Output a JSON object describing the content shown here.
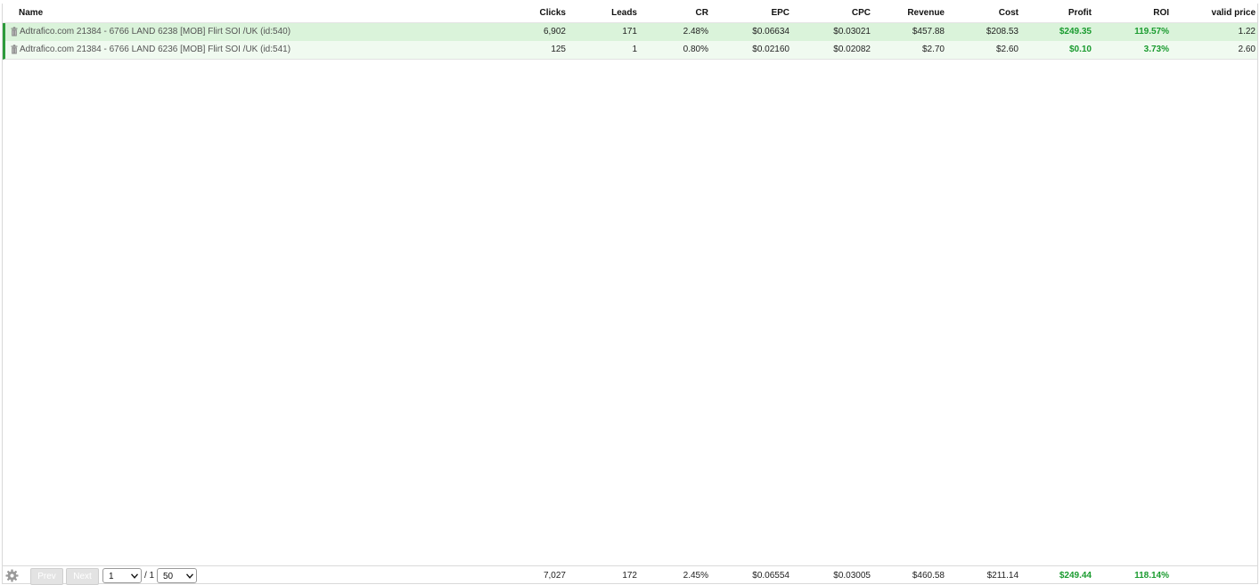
{
  "table": {
    "columns": [
      "Name",
      "Clicks",
      "Leads",
      "CR",
      "EPC",
      "CPC",
      "Revenue",
      "Cost",
      "Profit",
      "ROI",
      "valid price"
    ],
    "rows": [
      {
        "name": "Adtrafico.com 21384 - 6766 LAND 6238 [MOB] Flirt SOI /UK (id:540)",
        "clicks": "6,902",
        "leads": "171",
        "cr": "2.48%",
        "epc": "$0.06634",
        "cpc": "$0.03021",
        "revenue": "$457.88",
        "cost": "$208.53",
        "profit": "$249.35",
        "roi": "119.57%",
        "valid_price": "1.22"
      },
      {
        "name": "Adtrafico.com 21384 - 6766 LAND 6236 [MOB] Flirt SOI /UK (id:541)",
        "clicks": "125",
        "leads": "1",
        "cr": "0.80%",
        "epc": "$0.02160",
        "cpc": "$0.02082",
        "revenue": "$2.70",
        "cost": "$2.60",
        "profit": "$0.10",
        "roi": "3.73%",
        "valid_price": "2.60"
      }
    ],
    "totals": {
      "clicks": "7,027",
      "leads": "172",
      "cr": "2.45%",
      "epc": "$0.06554",
      "cpc": "$0.03005",
      "revenue": "$460.58",
      "cost": "$211.14",
      "profit": "$249.44",
      "roi": "118.14%"
    }
  },
  "pagination": {
    "prev_label": "Prev",
    "next_label": "Next",
    "page_value": "1",
    "page_count_label": "/ 1",
    "per_page_value": "50"
  },
  "icons": {
    "settings": "gear-icon",
    "row_action": "trash-icon"
  },
  "colors": {
    "row_highlight": "#daf3da",
    "row_light": "#f0faf0",
    "accent_green": "#1a9b2f",
    "row_marker": "#2d9b3b"
  }
}
